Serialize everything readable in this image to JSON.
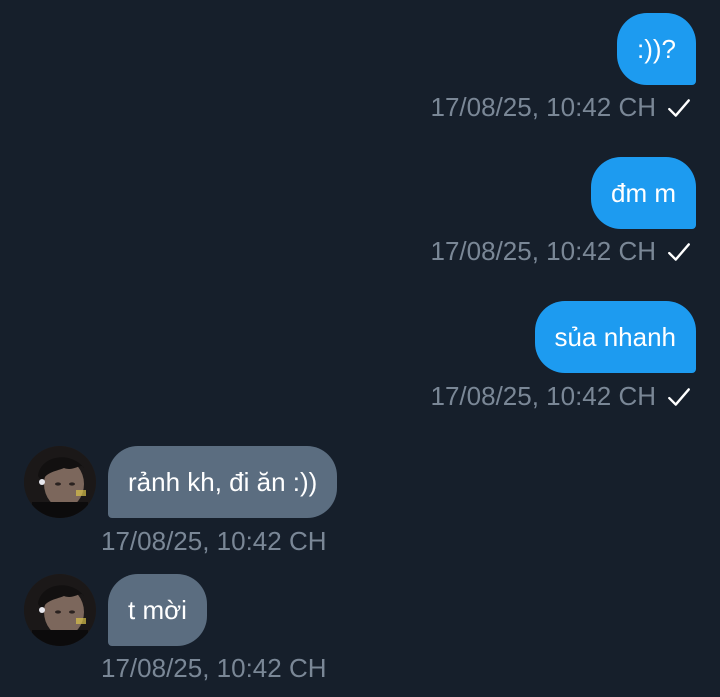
{
  "messages": [
    {
      "direction": "out",
      "text": ":))?",
      "timestamp": "17/08/25, 10:42 CH",
      "status_icon": "check-icon"
    },
    {
      "direction": "out",
      "text": "đm m",
      "timestamp": "17/08/25, 10:42 CH",
      "status_icon": "check-icon"
    },
    {
      "direction": "out",
      "text": "sủa nhanh",
      "timestamp": "17/08/25, 10:42 CH",
      "status_icon": "check-icon"
    },
    {
      "direction": "in",
      "text": "rảnh kh, đi ăn :))",
      "timestamp": "17/08/25, 10:42 CH",
      "avatar_icon": "user-avatar"
    },
    {
      "direction": "in",
      "text": "t mời",
      "timestamp": "17/08/25, 10:42 CH",
      "avatar_icon": "user-avatar"
    }
  ],
  "colors": {
    "background": "#161f2b",
    "outgoing_bubble": "#1d9bf0",
    "incoming_bubble": "#5b6d80",
    "timestamp_text": "#7a8796",
    "bubble_text": "#ffffff"
  }
}
